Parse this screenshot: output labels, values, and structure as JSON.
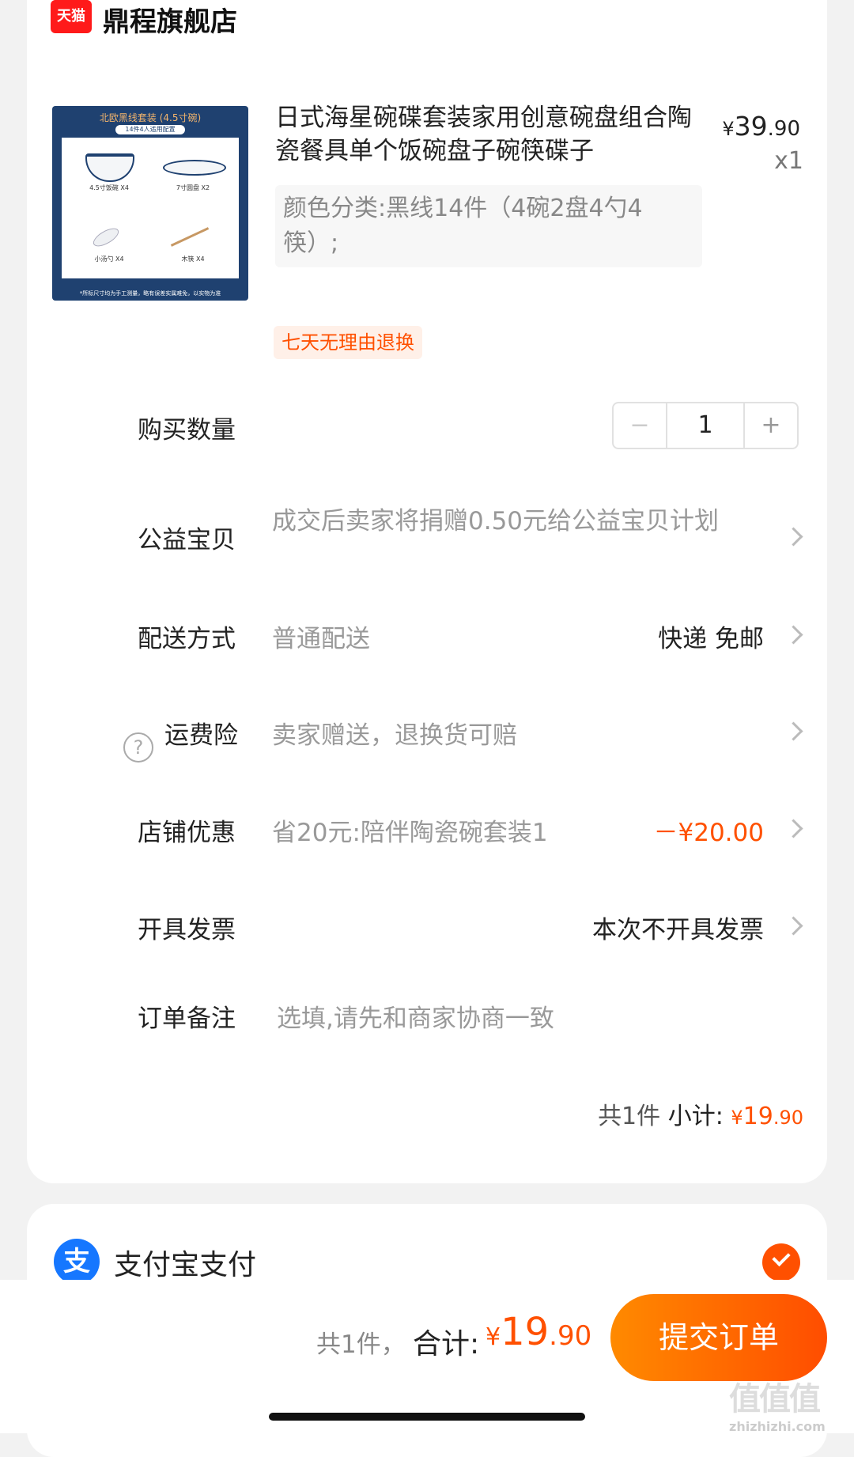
{
  "store": {
    "badge": "天猫",
    "name": "鼎程旗舰店"
  },
  "product": {
    "image": {
      "heading_main": "北欧黑线套装",
      "heading_size": "(4.5寸碗)",
      "subheading": "14件4人适用配置",
      "label_bowl": "4.5寸饭碗 X4",
      "label_plate": "7寸圆盘 X2",
      "label_spoon": "小汤勺 X4",
      "label_chopsticks": "木筷 X4",
      "footnote": "*所标尺寸均为手工测量，略有误差实属难免，以实物为准"
    },
    "title": "日式海星碗碟套装家用创意碗盘组合陶瓷餐具单个饭碗盘子碗筷碟子",
    "price_currency": "¥",
    "price_int": "39",
    "price_dec": ".90",
    "quantity_label": "x1",
    "variant": "颜色分类:黑线14件（4碗2盘4勺4筷）;",
    "returns_tag": "七天无理由退换"
  },
  "rows": {
    "quantity": {
      "label": "购买数量",
      "value": "1",
      "minus": "−",
      "plus": "+"
    },
    "charity": {
      "label": "公益宝贝",
      "value": "成交后卖家将捐赠0.50元给公益宝贝计划"
    },
    "delivery": {
      "label": "配送方式",
      "value": "普通配送",
      "right": "快递 免邮"
    },
    "shipping_insurance": {
      "icon": "?",
      "label": "运费险",
      "value": "卖家赠送，退换货可赔"
    },
    "store_discount": {
      "label": "店铺优惠",
      "value": "省20元:陪伴陶瓷碗套装1",
      "right": "－¥20.00"
    },
    "invoice": {
      "label": "开具发票",
      "right": "本次不开具发票"
    },
    "note": {
      "label": "订单备注",
      "placeholder": "选填,请先和商家协商一致"
    }
  },
  "subtotal": {
    "count_label": "共1件",
    "label": "小计:",
    "currency": "¥",
    "int": "19",
    "dec": ".90"
  },
  "payment": {
    "icon_char": "支",
    "label": "支付宝支付"
  },
  "bottom": {
    "count": "共1件，",
    "total_label": "合计:",
    "currency": "¥",
    "int": "19",
    "dec": ".90",
    "submit": "提交订单",
    "watermark": "值值值",
    "watermark_url": "zhizhizhi.com"
  },
  "colors": {
    "accent": "#ff5000",
    "alipay": "#1677ff",
    "tmall": "#ff1a1a"
  }
}
